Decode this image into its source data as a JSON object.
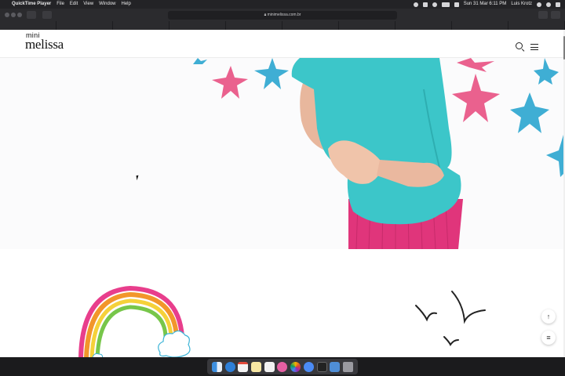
{
  "menubar": {
    "app_name": "QuickTime Player",
    "menus": [
      "File",
      "Edit",
      "View",
      "Window",
      "Help"
    ],
    "datetime": "Sun 31 Mar  6:11 PM",
    "user": "Luis Krotz"
  },
  "browser": {
    "url": "minimelissa.com.br",
    "tabs": [
      "",
      "",
      "",
      "",
      "",
      "",
      "",
      "",
      "",
      ""
    ]
  },
  "site": {
    "logo_top": "mini",
    "logo_main": "melissa",
    "icons": [
      "search-icon",
      "menu-icon",
      "arrow-up-icon",
      "list-icon"
    ]
  },
  "colors": {
    "shirt": "#3cc6c9",
    "skirt": "#e0357b",
    "star_pink": "#e6457a",
    "star_blue": "#2aa5cf"
  }
}
